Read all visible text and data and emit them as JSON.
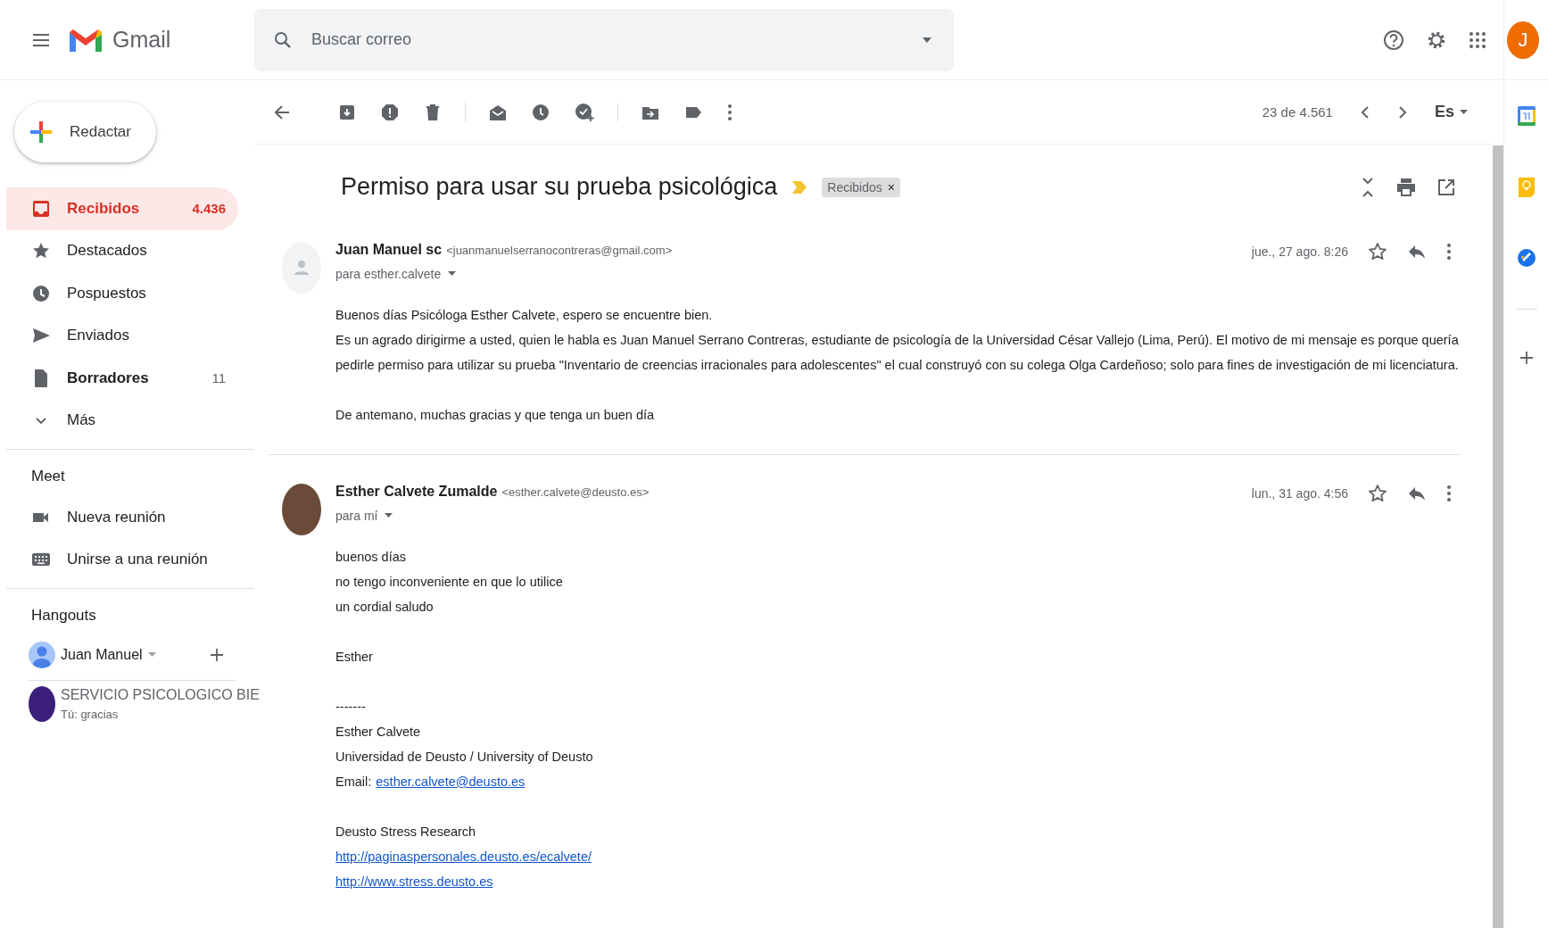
{
  "header": {
    "logo": "Gmail",
    "search": {
      "placeholder": "Buscar correo"
    },
    "avatar": "J"
  },
  "sidebar": {
    "compose": "Redactar",
    "items": [
      {
        "kind": "inbox",
        "label": "Recibidos",
        "count": "4.436",
        "selected": true,
        "bold": true
      },
      {
        "kind": "star",
        "label": "Destacados",
        "selected": false,
        "bold": false
      },
      {
        "kind": "clock",
        "label": "Pospuestos",
        "selected": false,
        "bold": false
      },
      {
        "kind": "send",
        "label": "Enviados",
        "selected": false,
        "bold": false
      },
      {
        "kind": "draft",
        "label": "Borradores",
        "count": "11",
        "selected": false,
        "bold": true
      },
      {
        "kind": "more",
        "label": "Más",
        "selected": false,
        "bold": false
      }
    ],
    "meet": {
      "title": "Meet",
      "items": [
        {
          "kind": "video",
          "label": "Nueva reunión"
        },
        {
          "kind": "keyboard",
          "label": "Unirse a una reunión"
        }
      ]
    },
    "hangouts": {
      "title": "Hangouts",
      "user": "Juan Manuel",
      "conversations": [
        {
          "name": "SERVICIO PSICOLOGICO BIE",
          "preview": "Tú: gracias"
        }
      ]
    }
  },
  "toolbar": {
    "counter": "23 de 4.561",
    "language": "Es"
  },
  "thread": {
    "subject": "Permiso para usar su prueba psicológica",
    "label": "Recibidos",
    "label_close": "×",
    "messages": [
      {
        "kind": "generic",
        "sender": "Juan Manuel sc",
        "email": "<juanmanuelserranocontreras@gmail.com>",
        "to": "para esther.calvete",
        "date": "jue., 27 ago. 8:26",
        "starred": false,
        "paragraphs": [
          [
            {
              "text": "Buenos días Psicóloga Esther Calvete, espero se encuentre bien."
            },
            {
              "text": "Es un agrado dirigirme a usted, quien le habla es Juan Manuel Serrano Contreras, estudiante de psicología de la Universidad César Vallejo (Lima, Perú). El motivo de mi mensaje es porque quería pedirle permiso para utilizar su prueba \"Inventario de creencias irracionales para adolescentes\" el cual construyó con su colega Olga Cardeñoso; solo para fines de investigación de mi licenciatura."
            }
          ],
          [
            {
              "text": "De antemano, muchas gracias y que tenga un buen día"
            }
          ]
        ]
      },
      {
        "kind": "photo",
        "sender": "Esther Calvete Zumalde",
        "email": "<esther.calvete@deusto.es>",
        "to": "para mí",
        "date": "lun., 31 ago. 4:56",
        "starred": false,
        "paragraphs": [
          [
            {
              "text": "buenos días"
            },
            {
              "text": "no tengo inconveniente en que lo utilice"
            },
            {
              "text": "un cordial saludo"
            }
          ],
          [
            {
              "text": "Esther"
            }
          ],
          [
            {
              "text": "-------"
            },
            {
              "text": "Esther Calvete"
            },
            {
              "text": "Universidad de Deusto / University of Deusto"
            },
            {
              "text": "Email:",
              "link": "esther.calvete@deusto.es"
            }
          ],
          [
            {
              "text": "Deusto Stress Research"
            },
            {
              "link": "http://paginaspersonales.deusto.es/ecalvete/"
            },
            {
              "link": "http://www.stress.deusto.es"
            }
          ]
        ]
      }
    ]
  }
}
